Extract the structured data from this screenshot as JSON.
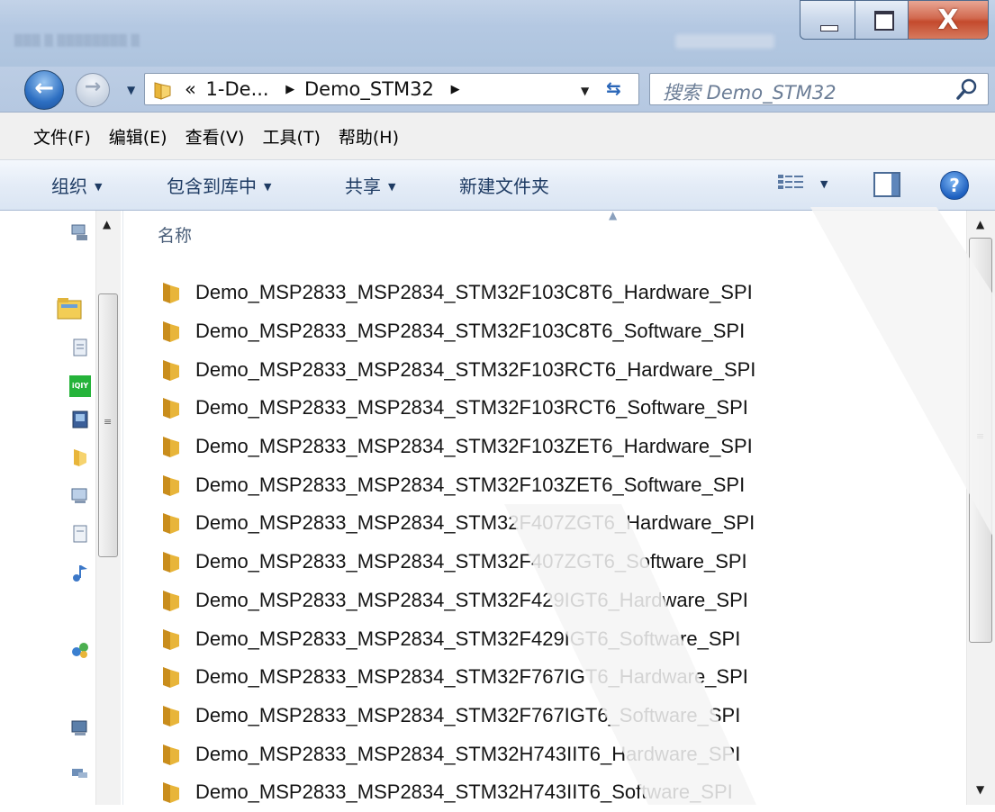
{
  "window": {
    "caption_buttons": {
      "minimize": "—",
      "maximize": "□",
      "close": "X"
    }
  },
  "address_bar": {
    "overflow": "«",
    "crumbs": [
      "1-De...",
      "Demo_STM32"
    ],
    "separator": "▶",
    "search_placeholder": "搜索 Demo_STM32"
  },
  "menu": {
    "items": [
      "文件(F)",
      "编辑(E)",
      "查看(V)",
      "工具(T)",
      "帮助(H)"
    ]
  },
  "toolbar": {
    "organize": "组织",
    "include_in_library": "包含到库中",
    "share": "共享",
    "new_folder": "新建文件夹",
    "help": "?"
  },
  "list": {
    "column_name": "名称",
    "items": [
      "Demo_MSP2833_MSP2834_STM32F103C8T6_Hardware_SPI",
      "Demo_MSP2833_MSP2834_STM32F103C8T6_Software_SPI",
      "Demo_MSP2833_MSP2834_STM32F103RCT6_Hardware_SPI",
      "Demo_MSP2833_MSP2834_STM32F103RCT6_Software_SPI",
      "Demo_MSP2833_MSP2834_STM32F103ZET6_Hardware_SPI",
      "Demo_MSP2833_MSP2834_STM32F103ZET6_Software_SPI",
      "Demo_MSP2833_MSP2834_STM32F407ZGT6_Hardware_SPI",
      "Demo_MSP2833_MSP2834_STM32F407ZGT6_Software_SPI",
      "Demo_MSP2833_MSP2834_STM32F429IGT6_Hardware_SPI",
      "Demo_MSP2833_MSP2834_STM32F429IGT6_Software_SPI",
      "Demo_MSP2833_MSP2834_STM32F767IGT6_Hardware_SPI",
      "Demo_MSP2833_MSP2834_STM32F767IGT6_Software_SPI",
      "Demo_MSP2833_MSP2834_STM32H743IIT6_Hardware_SPI",
      "Demo_MSP2833_MSP2834_STM32H743IIT6_Software_SPI"
    ]
  },
  "colors": {
    "folder": "#e8b53a",
    "folder_dark": "#c98d1c",
    "accent": "#2d6fc2",
    "close_button": "#c44a2d"
  }
}
